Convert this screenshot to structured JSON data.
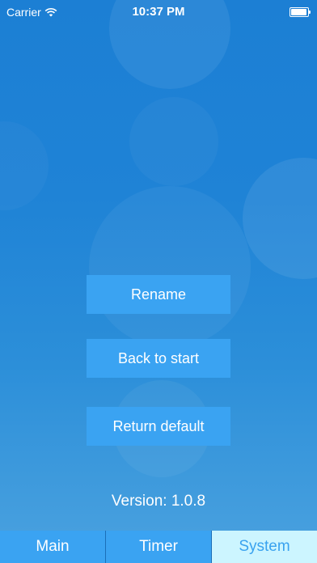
{
  "status_bar": {
    "carrier": "Carrier",
    "time": "10:37 PM",
    "wifi_icon": "wifi-icon",
    "battery_icon": "battery-icon"
  },
  "actions": {
    "rename_label": "Rename",
    "back_to_start_label": "Back to start",
    "return_default_label": "Return default"
  },
  "version_text": "Version: 1.0.8",
  "tab_bar": {
    "tabs": [
      {
        "label": "Main",
        "selected": false
      },
      {
        "label": "Timer",
        "selected": false
      },
      {
        "label": "System",
        "selected": true
      }
    ]
  },
  "colors": {
    "background": "#1f83d6",
    "button": "#3aa3f2",
    "selected_tab_bg": "#ccf5ff",
    "selected_tab_text": "#39a2ef"
  }
}
